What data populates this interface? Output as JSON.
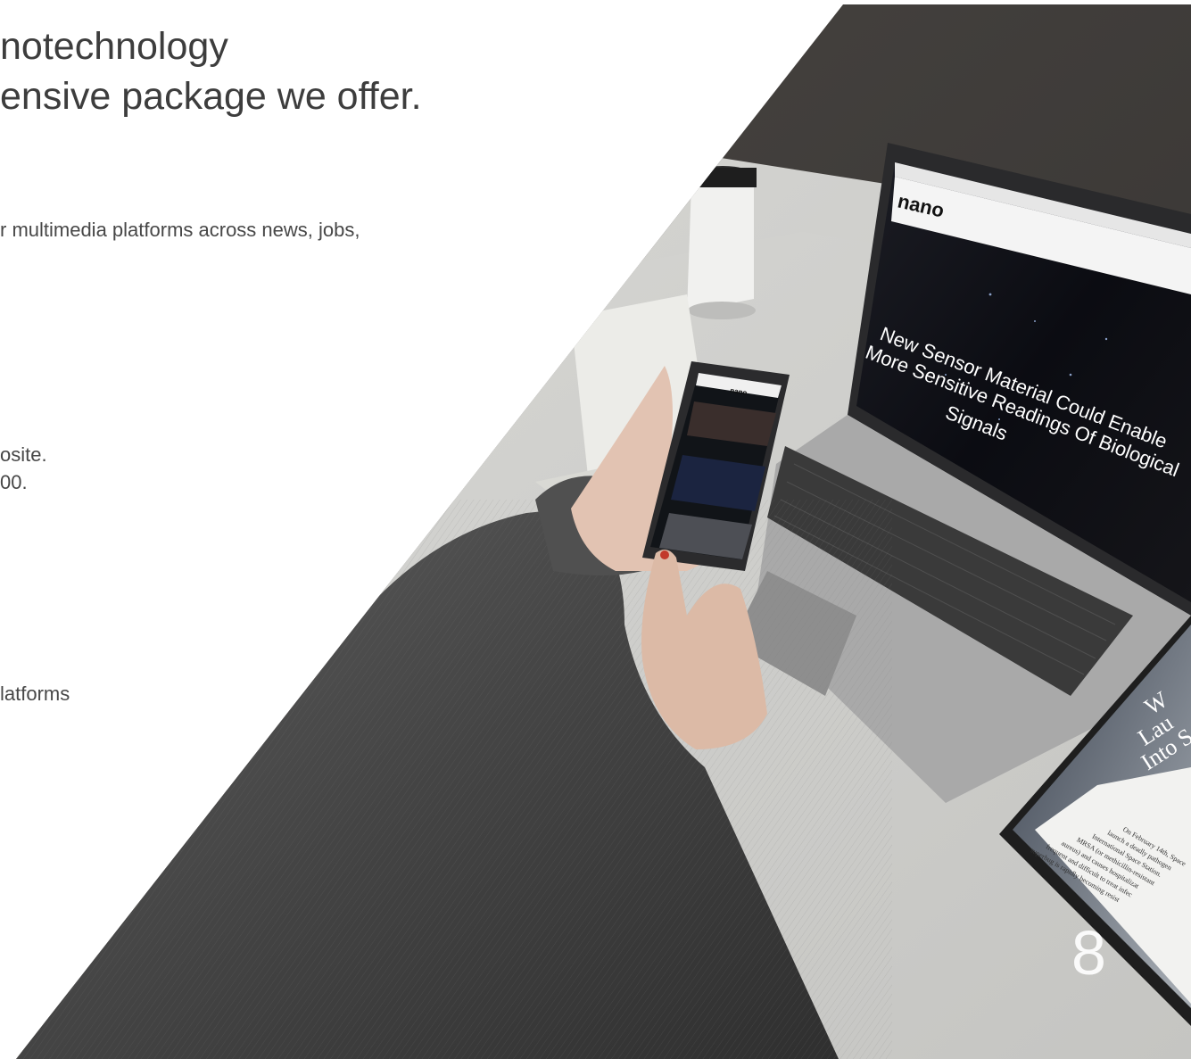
{
  "headline": {
    "line1": "notechnology",
    "line2": "ensive package we offer."
  },
  "body": {
    "line1": "r multimedia platforms across news, jobs,",
    "line2": "osite.",
    "line3": "00.",
    "line4": "latforms"
  },
  "photo": {
    "laptop_logo": "nano",
    "phone_logo": "nano",
    "laptop_headline": [
      "New Sensor Material Could Enable",
      "More Sensitive Readings Of Biological",
      "Signals"
    ],
    "tablet_headline": [
      "W",
      "Lau",
      "Into S"
    ],
    "tablet_body": [
      "On February 14th, Space",
      "launch a deadly pathogen",
      "International Space Station.",
      "MRSA (or methicillin-resistant",
      "aureus) and causes hospitalizat",
      "frequent and difficult to treat infec",
      "superbug is rapidly becoming resist"
    ]
  },
  "page_number": "8"
}
